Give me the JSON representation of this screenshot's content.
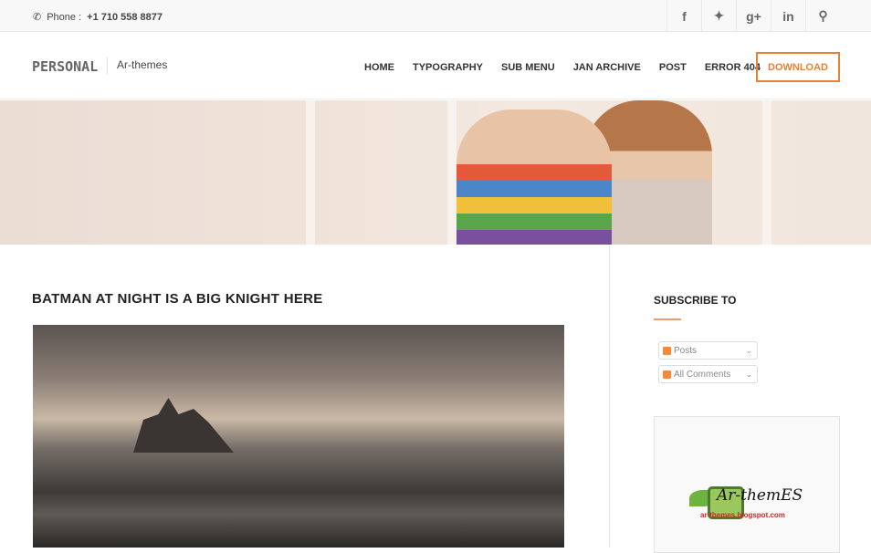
{
  "topbar": {
    "phone_label": "Phone :",
    "phone_number": "+1 710 558 8877",
    "social": [
      "facebook-icon",
      "twitter-icon",
      "google-plus-icon",
      "linkedin-icon",
      "search-icon"
    ]
  },
  "header": {
    "logo": "PERSONAL",
    "tagline": "Ar-themes",
    "nav": [
      "HOME",
      "TYPOGRAPHY",
      "SUB MENU",
      "JAN ARCHIVE",
      "POST",
      "ERROR 404"
    ],
    "download": "DOWNLOAD",
    "accent": "#e8803a"
  },
  "post": {
    "title": "BATMAN AT NIGHT IS A BIG KNIGHT HERE"
  },
  "sidebar": {
    "subscribe_title": "SUBSCRIBE TO",
    "feeds": [
      "Posts",
      "All Comments"
    ],
    "ad_logo_text": "Ar-themES",
    "ad_logo_url": "ar-themes.blogspot.com"
  }
}
